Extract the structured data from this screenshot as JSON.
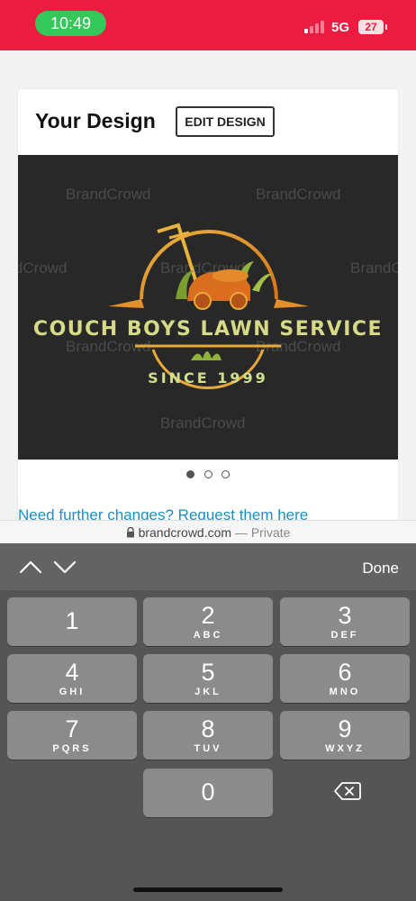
{
  "status": {
    "time": "10:49",
    "network": "5G",
    "battery": "27"
  },
  "card": {
    "title": "Your Design",
    "edit_button": "EDIT DESIGN",
    "request_link": "Need further changes? Request them here"
  },
  "logo": {
    "name_line": "COUCH BOYS LAWN SERVICE",
    "since_line": "SINCE 1999",
    "watermark": "BrandCrowd",
    "colors": {
      "gold": "#e8a93a",
      "orange": "#e07a1e",
      "green": "#9bbf3a",
      "text": "#d8dc8a"
    }
  },
  "carousel": {
    "count": 3,
    "active": 0
  },
  "url_bar": {
    "domain": "brandcrowd.com",
    "separator": " — ",
    "mode": "Private"
  },
  "keyboard": {
    "done": "Done",
    "keys": [
      {
        "num": "1",
        "letters": ""
      },
      {
        "num": "2",
        "letters": "ABC"
      },
      {
        "num": "3",
        "letters": "DEF"
      },
      {
        "num": "4",
        "letters": "GHI"
      },
      {
        "num": "5",
        "letters": "JKL"
      },
      {
        "num": "6",
        "letters": "MNO"
      },
      {
        "num": "7",
        "letters": "PQRS"
      },
      {
        "num": "8",
        "letters": "TUV"
      },
      {
        "num": "9",
        "letters": "WXYZ"
      },
      {
        "num": "0",
        "letters": ""
      }
    ],
    "icons": [
      "chevron-up-icon",
      "chevron-down-icon",
      "backspace-icon"
    ]
  }
}
